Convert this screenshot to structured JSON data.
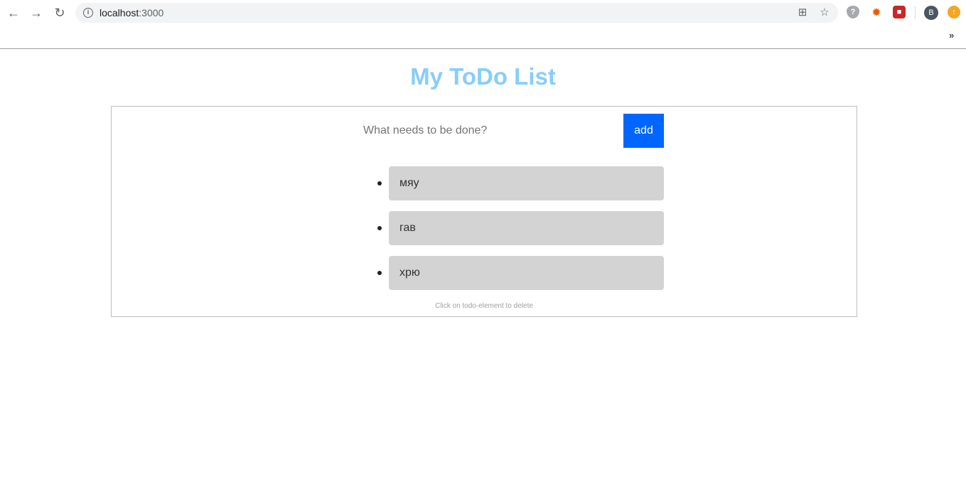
{
  "browser": {
    "url_host": "localhost",
    "url_port": ":3000",
    "profile_initial": "B",
    "bookmarks_overflow": "»"
  },
  "page": {
    "title": "My ToDo List",
    "input_placeholder": "What needs to be done?",
    "add_label": "add",
    "hint": "Click on todo-element to delete",
    "todos": [
      "мяу",
      "гав",
      "хрю"
    ]
  },
  "colors": {
    "title": "#87cefa",
    "add_button": "#0066ff",
    "todo_item_bg": "#d3d3d3"
  }
}
